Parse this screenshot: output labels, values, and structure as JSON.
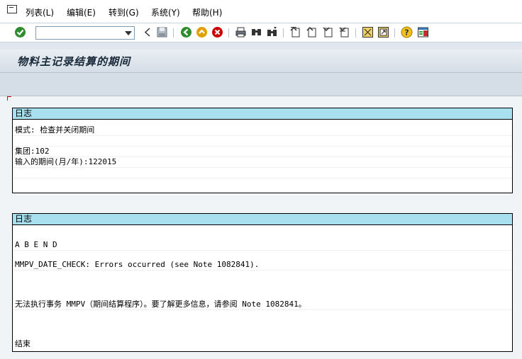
{
  "menu": {
    "items": [
      {
        "label": "列表(L)"
      },
      {
        "label": "编辑(E)"
      },
      {
        "label": "转到(G)"
      },
      {
        "label": "系统(Y)"
      },
      {
        "label": "帮助(H)"
      }
    ]
  },
  "toolbar": {
    "command_value": "",
    "icons": [
      "enter-check-icon",
      "command-dropdown-icon",
      "back-arrow-icon",
      "save-icon",
      "back-icon",
      "exit-icon",
      "cancel-icon",
      "print-icon",
      "find-icon",
      "find-next-icon",
      "first-page-icon",
      "prev-page-icon",
      "next-page-icon",
      "last-page-icon",
      "new-session-icon",
      "shortcut-icon",
      "help-icon",
      "layout-icon"
    ]
  },
  "page": {
    "title": "物料主记录结算的期间"
  },
  "log1": {
    "header": "日志",
    "rows": [
      "模式: 检查并关闭期间",
      "",
      "集团:102",
      "输入的期间(月/年):122015",
      "",
      ""
    ]
  },
  "log2": {
    "header": "日志",
    "rows": [
      "A B E N D",
      "",
      "MMPV_DATE_CHECK: Errors occurred (see Note 1082841).",
      "",
      "",
      "",
      "无法执行事务 MMPV（期间结算程序）。要了解更多信息，请参阅 Note 1082841。",
      "",
      "",
      "",
      "结束"
    ]
  },
  "colors": {
    "log_header_bg": "#a8e0f0",
    "titlebar_bg": "#dfe6ed",
    "ok_icon": "#2e8b2e",
    "back_icon": "#2e8b2e",
    "exit_icon": "#e0a000",
    "cancel_icon": "#cc0000"
  }
}
